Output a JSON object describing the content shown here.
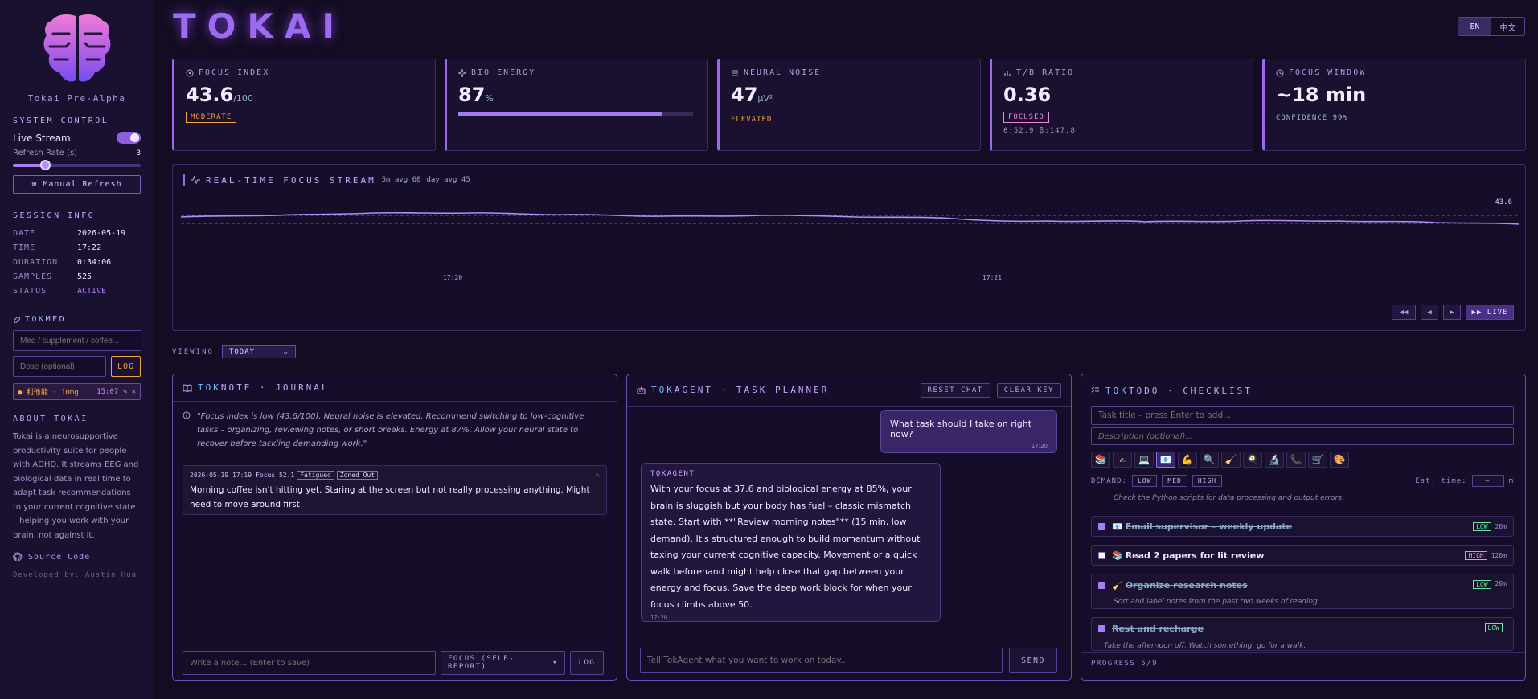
{
  "sidebar": {
    "brand": "Tokai Pre-Alpha",
    "system_control": {
      "title": "SYSTEM CONTROL",
      "live_stream_label": "Live Stream",
      "live_stream_on": true,
      "refresh_rate_label": "Refresh Rate (s)",
      "refresh_rate_value": "3",
      "refresh_fraction": 0.25,
      "manual_refresh_label": "⊕ Manual Refresh"
    },
    "session_info": {
      "title": "SESSION INFO",
      "rows": [
        {
          "key": "DATE",
          "value": "2026-05-19"
        },
        {
          "key": "TIME",
          "value": "17:22"
        },
        {
          "key": "DURATION",
          "value": "0:34:06"
        },
        {
          "key": "SAMPLES",
          "value": "525"
        },
        {
          "key": "STATUS",
          "value": "ACTIVE"
        }
      ]
    },
    "tokmed": {
      "title_prefix": "TOK",
      "title_rest": "MED",
      "med_placeholder": "Med / supplement / coffee...",
      "dose_placeholder": "Dose (optional)",
      "log_label": "LOG",
      "entry_name": "● 利他能 · 10mg",
      "entry_time": "15:07 ✎ ✕"
    },
    "about": {
      "title": "ABOUT TOKAI",
      "text": "Tokai is a neurosupportive productivity suite for people with ADHD. It streams EEG and biological data in real time to adapt task recommendations to your current cognitive state – helping you work with your brain, not against it."
    },
    "source_code_label": "Source Code",
    "developer": "Developed by: Austin Hua"
  },
  "header": {
    "title": "TOKAI",
    "lang_en": "EN",
    "lang_zh": "中文"
  },
  "metrics": {
    "focus_index": {
      "label": "FOCUS INDEX",
      "value": "43.6",
      "unit": "/100",
      "tag": "MODERATE"
    },
    "bio_energy": {
      "label": "BIO ENERGY",
      "value": "87",
      "unit": "%",
      "fraction": 0.87
    },
    "neural_noise": {
      "label": "NEURAL NOISE",
      "value": "47",
      "unit": "μV²",
      "sub": "ELEVATED"
    },
    "tb_ratio": {
      "label": "T/B RATIO",
      "value": "0.36",
      "tag": "FOCUSED",
      "sub": "θ:52.9 β:147.8"
    },
    "focus_window": {
      "label": "FOCUS WINDOW",
      "value": "~18 min",
      "sub": "CONFIDENCE 99%"
    }
  },
  "stream": {
    "title": "REAL-TIME FOCUS STREAM",
    "sub1": "5m avg 60",
    "sub2": "day avg 45",
    "current_value": "43.6",
    "x_ticks": [
      "17:20",
      "17:21"
    ],
    "controls": [
      "◀◀",
      "◀",
      "▶"
    ],
    "live_label": "▶▶ LIVE"
  },
  "viewing": {
    "label": "VIEWING",
    "selected": "TODAY"
  },
  "toknote": {
    "title_prefix": "TOK",
    "title_rest": "NOTE · JOURNAL",
    "advice": "\"Focus index is low (43.6/100). Neural noise is elevated. Recommend switching to low-cognitive tasks – organizing, reviewing notes, or short breaks. Energy at 87%. Allow your neural state to recover before tackling demanding work.\"",
    "entry": {
      "timestamp": "2026-05-19 17:19",
      "focus": "Focus 52.1",
      "tags": [
        "Fatigued",
        "Zoned Out"
      ],
      "text": "Morning coffee isn't hitting yet. Staring at the screen but not really processing anything. Might need to move around first."
    },
    "note_placeholder": "Write a note… (Enter to save)",
    "focus_select": "FOCUS (SELF-REPORT)",
    "log_label": "LOG"
  },
  "tokagent": {
    "title_prefix": "TOK",
    "title_rest": "AGENT · TASK PLANNER",
    "reset_label": "RESET CHAT",
    "clear_label": "CLEAR KEY",
    "user_msg": "What task should I take on right now?",
    "user_time": "17:20",
    "agent_name": "TOKAGENT",
    "agent_msg": "With your focus at 37.6 and biological energy at 85%, your brain is sluggish but your body has fuel – classic mismatch state. Start with **\"Review morning notes\"** (15 min, low demand). It's structured enough to build momentum without taxing your current cognitive capacity. Movement or a quick walk beforehand might help close that gap between your energy and focus. Save the deep work block for when your focus climbs above 50.",
    "agent_time": "17:20",
    "input_placeholder": "Tell TokAgent what you want to work on today...",
    "send_label": "SEND"
  },
  "toktodo": {
    "title_prefix": "TOK",
    "title_rest": "TODO · CHECKLIST",
    "title_placeholder": "Task title – press Enter to add...",
    "desc_placeholder": "Description (optional)...",
    "categories": [
      "📚",
      "✍",
      "💻",
      "📧",
      "💪",
      "🔍",
      "🧹",
      "🍳",
      "🔬",
      "📞",
      "🛒",
      "🎨"
    ],
    "selected_category": 3,
    "demand_label": "DEMAND:",
    "demand_options": [
      "LOW",
      "MED",
      "HIGH"
    ],
    "est_time_label": "Est. time:",
    "est_time_value": "–",
    "est_time_unit": "m",
    "partial_desc": "Check the Python scripts for data processing and output errors.",
    "items": [
      {
        "icon": "📧",
        "title": "Email supervisor – weekly update",
        "done": true,
        "demand": "LOW",
        "mins": "20m",
        "desc": ""
      },
      {
        "icon": "📚",
        "title": "Read 2 papers for lit review",
        "done": false,
        "demand": "HIGH",
        "mins": "120m",
        "desc": ""
      },
      {
        "icon": "🧹",
        "title": "Organize research notes",
        "done": true,
        "demand": "LOW",
        "mins": "20m",
        "desc": "Sort and label notes from the past two weeks of reading."
      },
      {
        "icon": "",
        "title": "Rest and recharge",
        "done": true,
        "demand": "LOW",
        "mins": "",
        "desc": "Take the afternoon off. Watch something, go for a walk."
      }
    ],
    "progress": "PROGRESS 5/9"
  },
  "colors": {
    "accent": "#9a66f2",
    "background": "#140c22",
    "warning": "#f2a640",
    "success": "#6ee6a0"
  }
}
